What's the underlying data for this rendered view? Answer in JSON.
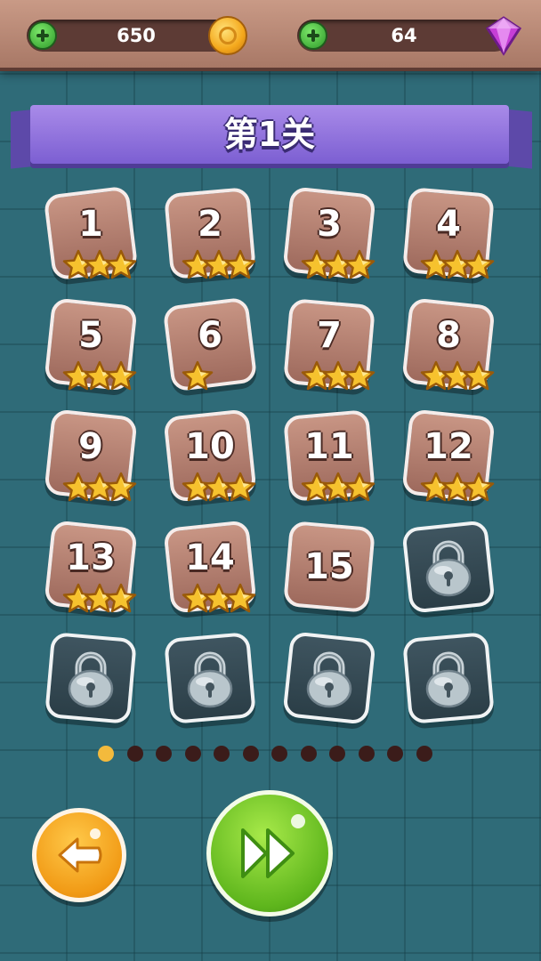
{
  "currency": {
    "coins": "650",
    "gems": "64"
  },
  "title": "第1关",
  "levels": [
    {
      "number": "1",
      "stars": 3,
      "locked": false
    },
    {
      "number": "2",
      "stars": 3,
      "locked": false
    },
    {
      "number": "3",
      "stars": 3,
      "locked": false
    },
    {
      "number": "4",
      "stars": 3,
      "locked": false
    },
    {
      "number": "5",
      "stars": 3,
      "locked": false
    },
    {
      "number": "6",
      "stars": 1,
      "locked": false
    },
    {
      "number": "7",
      "stars": 3,
      "locked": false
    },
    {
      "number": "8",
      "stars": 3,
      "locked": false
    },
    {
      "number": "9",
      "stars": 3,
      "locked": false
    },
    {
      "number": "10",
      "stars": 3,
      "locked": false
    },
    {
      "number": "11",
      "stars": 3,
      "locked": false
    },
    {
      "number": "12",
      "stars": 3,
      "locked": false
    },
    {
      "number": "13",
      "stars": 3,
      "locked": false
    },
    {
      "number": "14",
      "stars": 3,
      "locked": false
    },
    {
      "number": "15",
      "stars": 0,
      "locked": false
    },
    {
      "number": "",
      "stars": 0,
      "locked": true
    },
    {
      "number": "",
      "stars": 0,
      "locked": true
    },
    {
      "number": "",
      "stars": 0,
      "locked": true
    },
    {
      "number": "",
      "stars": 0,
      "locked": true
    },
    {
      "number": "",
      "stars": 0,
      "locked": true
    }
  ],
  "pagination": {
    "total_pages": 12,
    "current_page": 1
  },
  "icons": {
    "add_coins": "plus-icon",
    "coin": "coin-icon",
    "add_gems": "plus-icon",
    "gem": "gem-icon",
    "star": "star-icon",
    "lock": "lock-icon",
    "back": "arrow-left-icon",
    "next": "fast-forward-icon"
  },
  "colors": {
    "background": "#2f6b78",
    "banner": "#8b6fdc",
    "tile": "#b4806f",
    "locked_tile": "#34474f",
    "star": "#f6c22e",
    "active_dot": "#f3ba3c",
    "back_button": "#f4a21a",
    "next_button": "#6cc425"
  }
}
